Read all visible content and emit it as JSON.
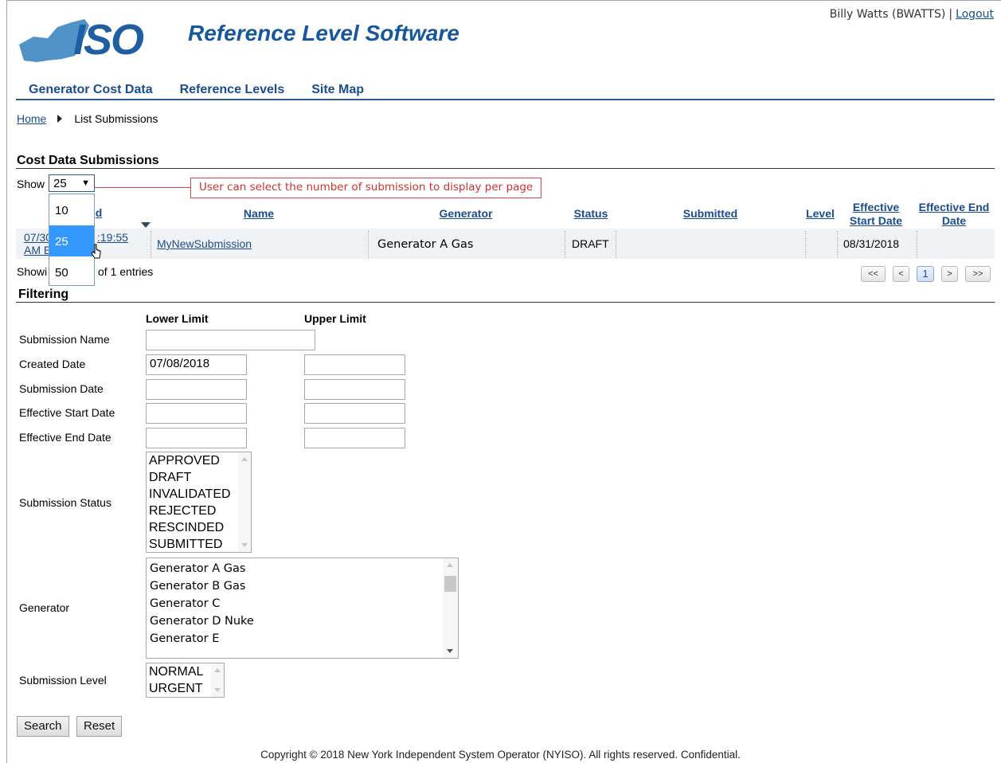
{
  "header": {
    "app_title": "Reference Level Software",
    "user_name": "Billy Watts (BWATTS)",
    "separator": "|",
    "logout": "Logout"
  },
  "nav": [
    "Generator Cost Data",
    "Reference Levels",
    "Site Map"
  ],
  "breadcrumb": {
    "home": "Home",
    "current": "List Submissions"
  },
  "submissions": {
    "title": "Cost Data Submissions",
    "show_label": "Show",
    "show_value": "25",
    "show_options": [
      "10",
      "25",
      "50"
    ],
    "callout": "User can select the number of submission to display per page",
    "columns": {
      "created_partial": "d",
      "name": "Name",
      "generator": "Generator",
      "status": "Status",
      "submitted": "Submitted",
      "level": "Level",
      "eff_start": "Effective Start Date",
      "eff_end": "Effective End Date"
    },
    "row": {
      "created_l1a": "07/30",
      "created_l1b": ":19:55",
      "created_l2": "AM E",
      "name": "MyNewSubmission",
      "generator": "Generator A Gas",
      "status": "DRAFT",
      "submitted": "",
      "level": "",
      "eff_start": "08/31/2018",
      "eff_end": ""
    },
    "showing_a": "Showi",
    "showing_b": "of 1 entries",
    "pager": [
      "<<",
      "<",
      "1",
      ">",
      ">>"
    ]
  },
  "filtering": {
    "title": "Filtering",
    "lower": "Lower Limit",
    "upper": "Upper Limit",
    "labels": {
      "name": "Submission Name",
      "created": "Created Date",
      "submission_date": "Submission Date",
      "eff_start": "Effective Start Date",
      "eff_end": "Effective End Date",
      "status": "Submission Status",
      "generator": "Generator",
      "level": "Submission Level"
    },
    "created_lower": "07/08/2018",
    "status_options": [
      "APPROVED",
      "DRAFT",
      "INVALIDATED",
      "REJECTED",
      "RESCINDED",
      "SUBMITTED"
    ],
    "generator_options": [
      "Generator A Gas",
      "Generator B Gas",
      "Generator C",
      "Generator D Nuke",
      "Generator E"
    ],
    "level_options": [
      "NORMAL",
      "URGENT"
    ],
    "search": "Search",
    "reset": "Reset"
  },
  "footer": "Copyright © 2018 New York Independent System Operator (NYISO). All rights reserved. Confidential."
}
